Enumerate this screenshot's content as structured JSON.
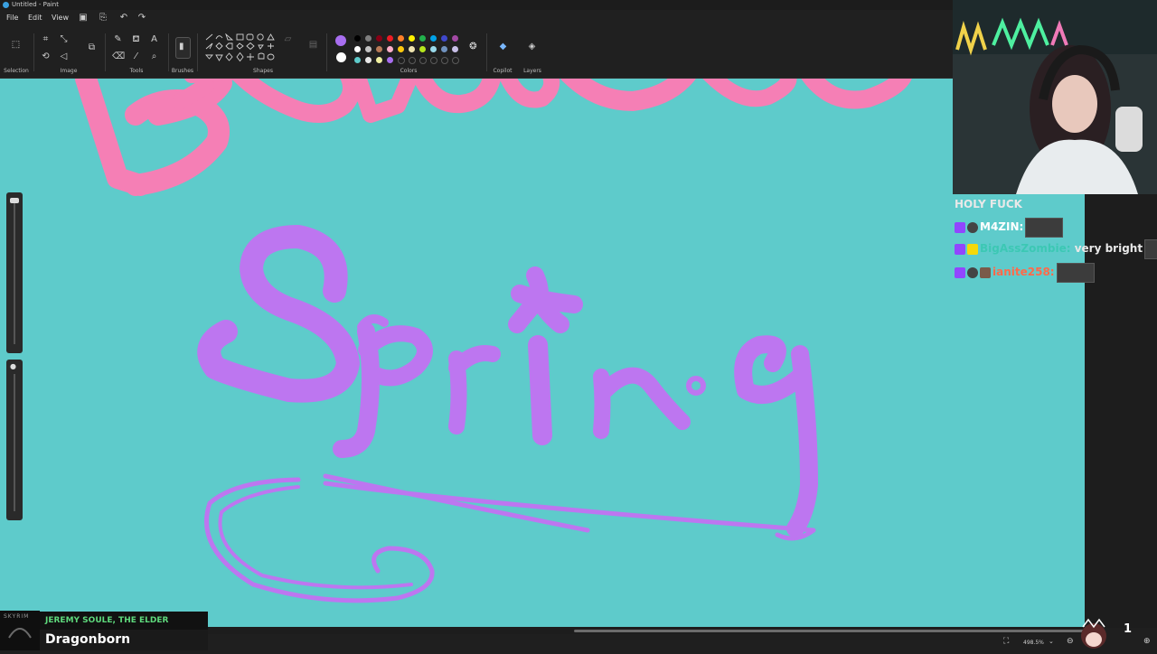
{
  "window": {
    "title": "Untitled - Paint"
  },
  "menu": {
    "file": "File",
    "edit": "Edit",
    "view": "View"
  },
  "ribbon": {
    "groups": {
      "selection": "Selection",
      "image": "Image",
      "tools": "Tools",
      "brushes": "Brushes",
      "shapes": "Shapes",
      "colors": "Colors",
      "copilot": "Copilot",
      "layers": "Layers"
    },
    "primary_color": "#a86ef0",
    "secondary_color": "#ffffff",
    "palette": [
      "#000000",
      "#7f7f7f",
      "#880015",
      "#ed1c24",
      "#ff7f27",
      "#fff200",
      "#22b14c",
      "#00a2e8",
      "#3f48cc",
      "#a349a4",
      "#ffffff",
      "#c3c3c3",
      "#b97a57",
      "#ffaec9",
      "#ffc90e",
      "#efe4b0",
      "#b5e61d",
      "#99d9ea",
      "#7092be",
      "#c8bfe7",
      "#5ecbcb",
      "#e8e8e8",
      "#f0f0a0",
      "#a86ef0",
      "",
      "",
      "",
      "",
      "",
      ""
    ]
  },
  "canvas": {
    "background": "#5ecbcb",
    "pink": "#f57fb5",
    "purple": "#bd76f0"
  },
  "chat": {
    "header": "HOLY FUCK",
    "messages": [
      {
        "user": "M4ZIN:",
        "user_color": "#ffffff",
        "text": ""
      },
      {
        "user": "BigAssZombie:",
        "user_color": "#3cc8b4",
        "text": "very bright"
      },
      {
        "user": "ianite258:",
        "user_color": "#ff6a4a",
        "text": ""
      }
    ]
  },
  "now_playing": {
    "artist": "JEREMY SOULE, THE ELDER SCROLLS",
    "song": "Dragonborn",
    "art_label": "SKYRIM"
  },
  "status": {
    "zoom": "498.5%"
  },
  "overlay": {
    "counter": "1"
  }
}
